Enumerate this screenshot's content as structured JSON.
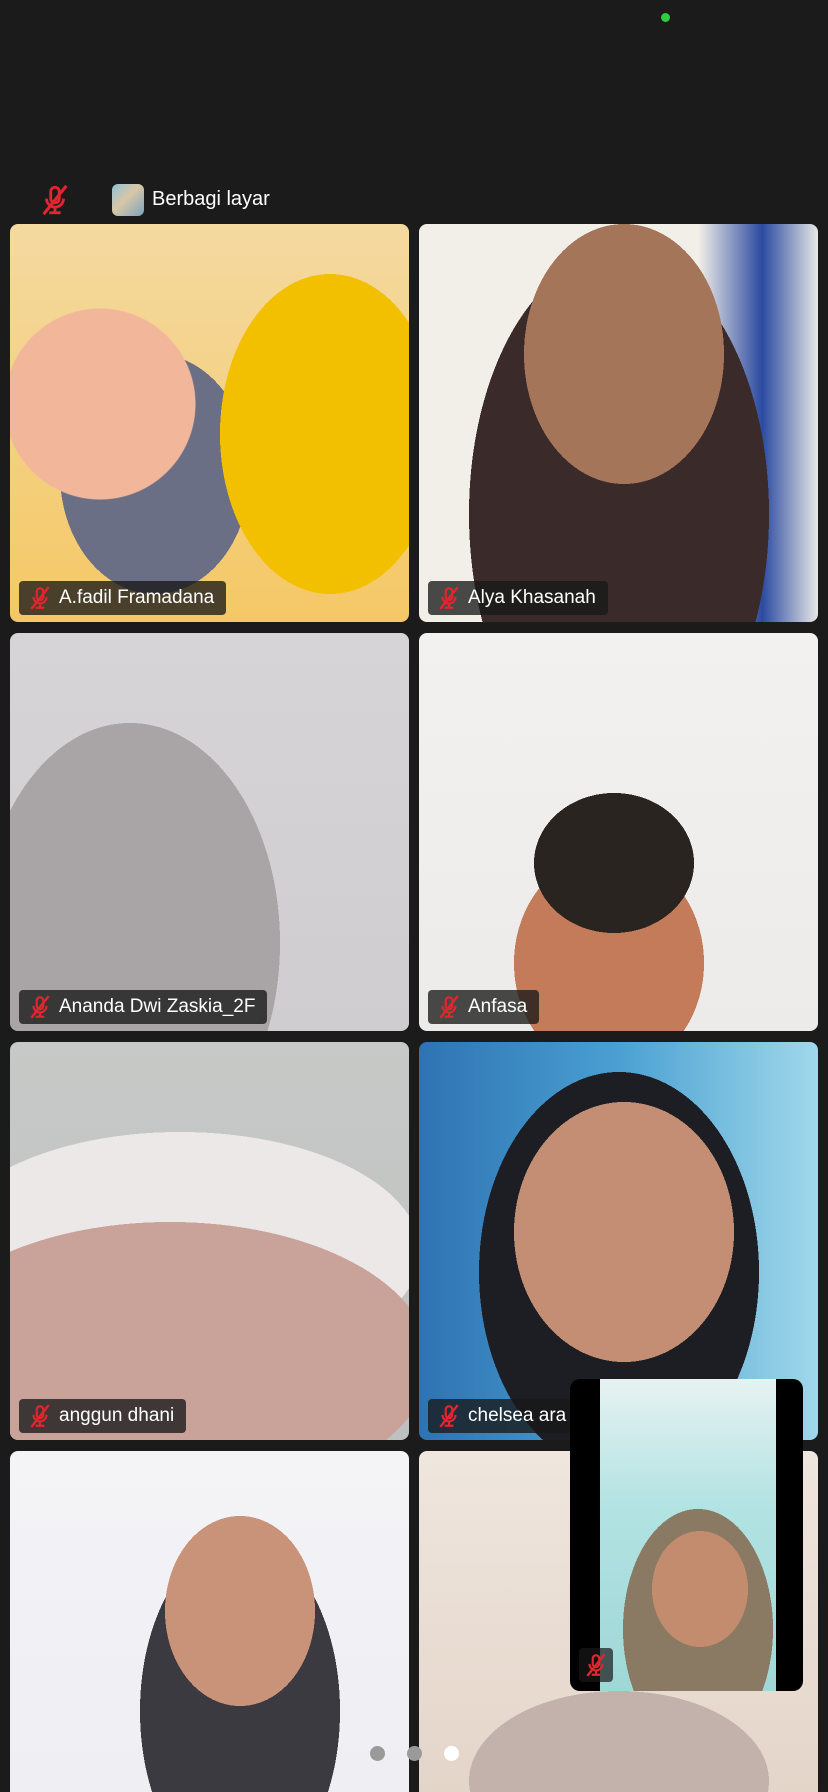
{
  "topbar": {
    "share_label": "Berbagi layar"
  },
  "participants": [
    {
      "name": "A.fadil Framadana",
      "muted": true
    },
    {
      "name": "Alya Khasanah",
      "muted": true
    },
    {
      "name": "Ananda Dwi Zaskia_2F",
      "muted": true
    },
    {
      "name": "Anfasa",
      "muted": true
    },
    {
      "name": "anggun dhani",
      "muted": true
    },
    {
      "name": "chelsea ara",
      "muted": true
    },
    {
      "name": "",
      "muted": false
    },
    {
      "name": "",
      "muted": false
    }
  ],
  "self_view": {
    "muted": true
  },
  "pagination": {
    "total_pages": 3,
    "current_page": 3
  },
  "colors": {
    "background": "#1b1b1c",
    "muted_red": "#e0262e",
    "online_dot": "#2ecc40"
  }
}
